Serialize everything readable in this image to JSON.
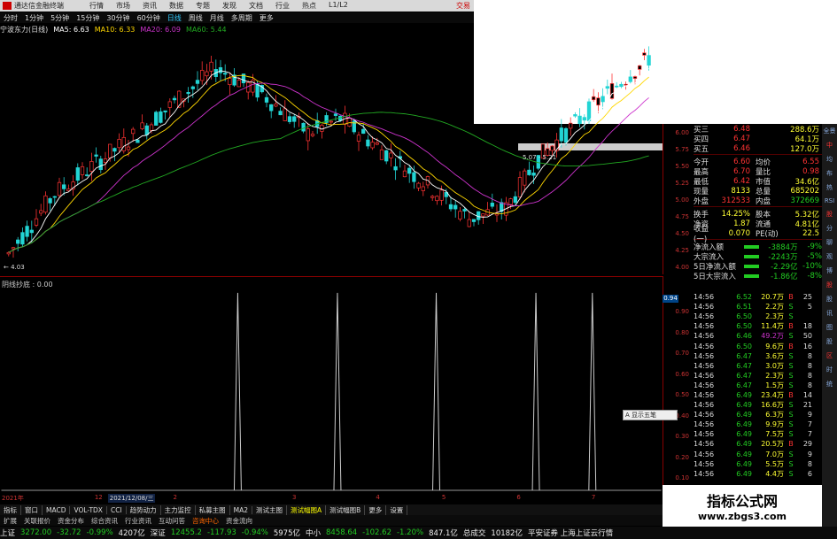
{
  "window": {
    "app_title": "通达信金融终端",
    "menu": [
      "行情",
      "市场",
      "资讯",
      "数据",
      "专题",
      "发现",
      "文档",
      "行业",
      "热点",
      "L1/L2"
    ],
    "trade_label": "交易"
  },
  "periods": {
    "items": [
      "分时",
      "1分钟",
      "5分钟",
      "15分钟",
      "30分钟",
      "60分钟",
      "日线",
      "周线",
      "月线",
      "多周期",
      "更多"
    ],
    "active_index": 6
  },
  "ma_line": {
    "stock": "宁波东力(日线)",
    "ma5": "MA5: 6.63",
    "ma10": "MA10: 6.33",
    "ma20": "MA20: 6.09",
    "ma60": "MA60: 5.44"
  },
  "chart_labels": {
    "low_mark": "4.03",
    "range_mark": "5.07 - 5.21"
  },
  "main_yaxis": [
    "6.00",
    "5.75",
    "5.50",
    "5.25",
    "5.00",
    "4.75",
    "4.50",
    "4.25",
    "4.00"
  ],
  "indicator": {
    "title": "阴线抄底 : 0.00",
    "badge": "0.94",
    "yaxis": [
      "0.90",
      "0.80",
      "0.70",
      "0.60",
      "0.50",
      "0.40",
      "0.30",
      "0.20",
      "0.10"
    ]
  },
  "timeaxis": {
    "year": "2021年",
    "m1": "12",
    "date": "2021/12/08/三",
    "labels": [
      "2",
      "3",
      "4",
      "5",
      "6",
      "7"
    ]
  },
  "tabs": {
    "items": [
      "指标",
      "窗口",
      "MACD",
      "VOL-TDX",
      "CCI",
      "趋势动力",
      "主力监控",
      "私募主图",
      "MA2",
      "测试主图",
      "测试幅图A",
      "测试幅图B",
      "更多",
      "设置"
    ],
    "active": "测试幅图A"
  },
  "tabs2": {
    "items": [
      "扩展",
      "关联报价",
      "资金分布",
      "综合资讯",
      "行业资讯",
      "互动问答",
      "咨询中心",
      "资金流向"
    ],
    "warn": "咨询中心"
  },
  "status": {
    "sh_label": "上证",
    "sh_val": "3272.00",
    "sh_chg": "-32.72",
    "sh_pct": "-0.99%",
    "sh_amt": "4207亿",
    "sz_label": "深证",
    "sz_val": "12455.2",
    "sz_chg": "-117.93",
    "sz_pct": "-0.94%",
    "sz_amt": "5975亿",
    "zx_label": "中小",
    "zx_val": "8458.64",
    "zx_chg": "-102.62",
    "zx_pct": "-1.20%",
    "zx_amt": "847.1亿",
    "total_label": "总成交",
    "total_val": "10182亿",
    "broker": "平安证券 上海上证云行情"
  },
  "quote": {
    "rows": [
      {
        "lab": "买三",
        "v1": "6.48",
        "lab2": "",
        "v2": "288.6万",
        "c1": "red",
        "c2": "yellow"
      },
      {
        "lab": "买四",
        "v1": "6.47",
        "lab2": "",
        "v2": "64.1万",
        "c1": "red",
        "c2": "yellow"
      },
      {
        "lab": "买五",
        "v1": "6.46",
        "lab2": "",
        "v2": "127.0万",
        "c1": "red",
        "c2": "yellow"
      },
      {
        "lab": "今开",
        "v1": "6.60",
        "lab2": "均价",
        "v2": "6.55",
        "c1": "red",
        "c2": "red"
      },
      {
        "lab": "最高",
        "v1": "6.70",
        "lab2": "量比",
        "v2": "0.98",
        "c1": "red",
        "c2": "red"
      },
      {
        "lab": "最低",
        "v1": "6.42",
        "lab2": "市值",
        "v2": "34.6亿",
        "c1": "red",
        "c2": "yellow"
      },
      {
        "lab": "现量",
        "v1": "8133",
        "lab2": "总量",
        "v2": "685202",
        "c1": "yellow",
        "c2": "yellow"
      },
      {
        "lab": "外盘",
        "v1": "312533",
        "lab2": "内盘",
        "v2": "372669",
        "c1": "red",
        "c2": "green"
      },
      {
        "lab": "换手",
        "v1": "14.25%",
        "lab2": "股本",
        "v2": "5.32亿",
        "c1": "yellow",
        "c2": "yellow"
      },
      {
        "lab": "净资",
        "v1": "1.87",
        "lab2": "流通",
        "v2": "4.81亿",
        "c1": "yellow",
        "c2": "yellow"
      },
      {
        "lab": "收益(一)",
        "v1": "0.070",
        "lab2": "PE(动)",
        "v2": "22.5",
        "c1": "yellow",
        "c2": "yellow"
      }
    ],
    "flows": [
      {
        "lab": "净流入额",
        "val": "-3884万",
        "pct": "-9%",
        "bar": "#2c2"
      },
      {
        "lab": "大宗流入",
        "val": "-2243万",
        "pct": "-5%",
        "bar": "#2c2"
      },
      {
        "lab": "5日净流入额",
        "val": "-2.29亿",
        "pct": "-10%",
        "bar": "#2c2"
      },
      {
        "lab": "5日大宗流入",
        "val": "-1.86亿",
        "pct": "-8%",
        "bar": "#2c2"
      }
    ]
  },
  "ticks": [
    {
      "t": "14:56",
      "p": "6.52",
      "v": "20.7万",
      "bs": "B",
      "n": "25",
      "purple": false
    },
    {
      "t": "14:56",
      "p": "6.51",
      "v": "2.2万",
      "bs": "S",
      "n": "5",
      "purple": false
    },
    {
      "t": "14:56",
      "p": "6.50",
      "v": "2.3万",
      "bs": "S",
      "n": "",
      "purple": false
    },
    {
      "t": "14:56",
      "p": "6.50",
      "v": "11.4万",
      "bs": "B",
      "n": "18",
      "purple": false
    },
    {
      "t": "14:56",
      "p": "6.46",
      "v": "49.2万",
      "bs": "S",
      "n": "50",
      "purple": true
    },
    {
      "t": "14:56",
      "p": "6.50",
      "v": "9.6万",
      "bs": "B",
      "n": "16",
      "purple": false
    },
    {
      "t": "14:56",
      "p": "6.47",
      "v": "3.6万",
      "bs": "S",
      "n": "8",
      "purple": false
    },
    {
      "t": "14:56",
      "p": "6.47",
      "v": "3.0万",
      "bs": "S",
      "n": "8",
      "purple": false
    },
    {
      "t": "14:56",
      "p": "6.47",
      "v": "2.3万",
      "bs": "S",
      "n": "8",
      "purple": false
    },
    {
      "t": "14:56",
      "p": "6.47",
      "v": "1.5万",
      "bs": "S",
      "n": "8",
      "purple": false
    },
    {
      "t": "14:56",
      "p": "6.49",
      "v": "23.4万",
      "bs": "B",
      "n": "14",
      "purple": false
    },
    {
      "t": "14:56",
      "p": "6.49",
      "v": "16.6万",
      "bs": "S",
      "n": "21",
      "purple": false
    },
    {
      "t": "14:56",
      "p": "6.49",
      "v": "6.3万",
      "bs": "S",
      "n": "9",
      "purple": false
    },
    {
      "t": "14:56",
      "p": "6.49",
      "v": "9.9万",
      "bs": "S",
      "n": "7",
      "purple": false
    },
    {
      "t": "14:56",
      "p": "6.49",
      "v": "7.5万",
      "bs": "S",
      "n": "7",
      "purple": false
    },
    {
      "t": "14:56",
      "p": "6.49",
      "v": "20.5万",
      "bs": "B",
      "n": "29",
      "purple": false
    },
    {
      "t": "14:56",
      "p": "6.49",
      "v": "7.0万",
      "bs": "S",
      "n": "9",
      "purple": false
    },
    {
      "t": "14:56",
      "p": "6.49",
      "v": "5.5万",
      "bs": "S",
      "n": "8",
      "purple": false
    },
    {
      "t": "14:56",
      "p": "6.49",
      "v": "4.4万",
      "bs": "S",
      "n": "6",
      "purple": false
    }
  ],
  "toolcol": [
    "全景",
    "中",
    "均",
    "布",
    "热",
    "RSI",
    "股",
    "分",
    "聊",
    "观",
    "博",
    "股",
    "股",
    "讯",
    "图",
    "股",
    "区",
    "时",
    "统"
  ],
  "popup": "A 显示五笔",
  "watermark": {
    "line1": "指标公式网",
    "line2": "www.zbgs3.com"
  },
  "colors": {
    "up": "#ff3333",
    "down": "#22d4d4",
    "ma5": "#ffffff",
    "ma10": "#ffd700",
    "ma20": "#cc33cc",
    "ma60": "#22aa22"
  },
  "chart_data": {
    "type": "candlestick",
    "y_range": [
      4.0,
      6.1
    ],
    "spikes_x_index": [
      53,
      74,
      95,
      116,
      137
    ]
  }
}
